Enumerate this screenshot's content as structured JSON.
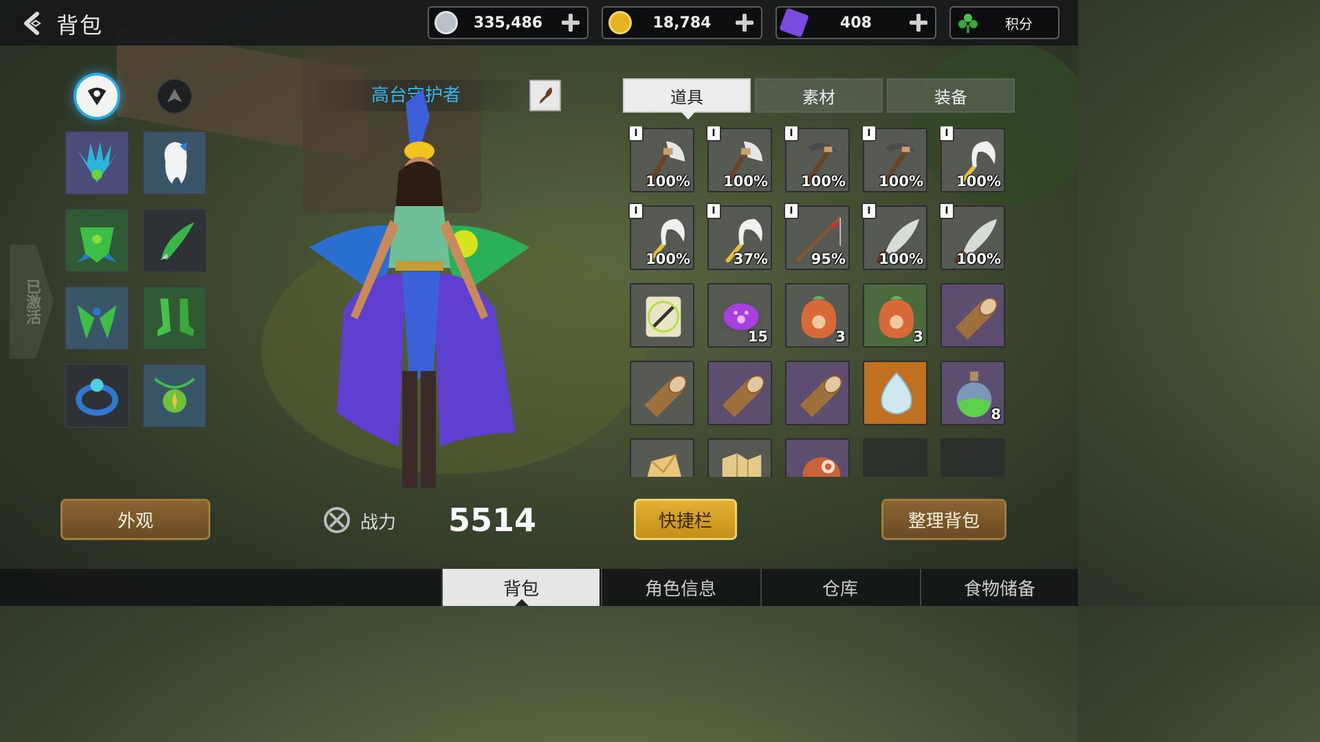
{
  "header": {
    "back_icon": "back-arrow-icon",
    "title": "背包",
    "currencies": [
      {
        "name": "silver-coin",
        "value": "335,486",
        "color": "#b9c0c9"
      },
      {
        "name": "gold-coin",
        "value": "18,784",
        "color": "#e6b422"
      },
      {
        "name": "purple-gem",
        "value": "408",
        "color": "#7b4be0"
      }
    ],
    "score_label": "积分"
  },
  "equipment": {
    "style_icons": [
      "flower-emblem-icon",
      "wing-emblem-icon"
    ],
    "side_tab_label": "已激活",
    "slots": [
      {
        "icon": "feather-headdress-icon",
        "rarity": "purple"
      },
      {
        "icon": "white-hair-icon",
        "rarity": "blue"
      },
      {
        "icon": "leaf-armor-icon",
        "rarity": "green"
      },
      {
        "icon": "green-blade-icon",
        "rarity": "dark"
      },
      {
        "icon": "leaf-gloves-icon",
        "rarity": "blue"
      },
      {
        "icon": "green-boots-icon",
        "rarity": "green"
      },
      {
        "icon": "blue-ring-icon",
        "rarity": "dark"
      },
      {
        "icon": "amulet-icon",
        "rarity": "blue"
      }
    ]
  },
  "character": {
    "name": "高台守护者",
    "rename_icon": "quill-icon",
    "power_label": "战力",
    "power_value": "5514",
    "appearance_button": "外观"
  },
  "inventory": {
    "tabs": [
      "道具",
      "素材",
      "装备"
    ],
    "active_tab": 0,
    "items": [
      {
        "icon": "stone-axe-icon",
        "label": "100%",
        "locked": true,
        "bg": "gray"
      },
      {
        "icon": "stone-axe-icon",
        "label": "100%",
        "locked": true,
        "bg": "gray"
      },
      {
        "icon": "pickaxe-icon",
        "label": "100%",
        "locked": true,
        "bg": "gray"
      },
      {
        "icon": "pickaxe-icon",
        "label": "100%",
        "locked": true,
        "bg": "gray"
      },
      {
        "icon": "sickle-icon",
        "label": "100%",
        "locked": true,
        "bg": "gray"
      },
      {
        "icon": "sickle-icon",
        "label": "100%",
        "locked": true,
        "bg": "gray"
      },
      {
        "icon": "sickle-icon",
        "label": "37%",
        "locked": true,
        "bg": "gray"
      },
      {
        "icon": "fishing-rod-icon",
        "label": "95%",
        "locked": true,
        "bg": "gray"
      },
      {
        "icon": "stone-knife-icon",
        "label": "100%",
        "locked": true,
        "bg": "gray"
      },
      {
        "icon": "stone-knife-icon",
        "label": "100%",
        "locked": true,
        "bg": "gray"
      },
      {
        "icon": "scroll-icon",
        "label": "",
        "locked": false,
        "bg": "gray"
      },
      {
        "icon": "paw-stone-icon",
        "label": "15",
        "locked": false,
        "bg": "gray"
      },
      {
        "icon": "seed-bag-icon",
        "label": "3",
        "locked": false,
        "bg": "gray"
      },
      {
        "icon": "seed-bag-icon",
        "label": "3",
        "locked": false,
        "bg": "green"
      },
      {
        "icon": "wood-log-icon",
        "label": "",
        "locked": false,
        "bg": "purple"
      },
      {
        "icon": "wood-log-icon",
        "label": "",
        "locked": false,
        "bg": "gray"
      },
      {
        "icon": "wood-log-icon",
        "label": "",
        "locked": false,
        "bg": "purple"
      },
      {
        "icon": "wood-log-icon",
        "label": "",
        "locked": false,
        "bg": "purple"
      },
      {
        "icon": "water-drop-icon",
        "label": "",
        "locked": false,
        "bg": "orange"
      },
      {
        "icon": "potion-icon",
        "label": "8",
        "locked": false,
        "bg": "purple"
      },
      {
        "icon": "fabric-icon",
        "label": "",
        "locked": false,
        "bg": "gray"
      },
      {
        "icon": "map-icon",
        "label": "",
        "locked": false,
        "bg": "gray"
      },
      {
        "icon": "meat-icon",
        "label": "",
        "locked": false,
        "bg": "purple"
      },
      {
        "icon": "",
        "label": "",
        "locked": false,
        "bg": "empty"
      },
      {
        "icon": "",
        "label": "",
        "locked": false,
        "bg": "empty"
      }
    ],
    "quickbar_button": "快捷栏",
    "sort_button": "整理背包"
  },
  "bottom_nav": {
    "tabs": [
      "背包",
      "角色信息",
      "仓库",
      "食物储备"
    ],
    "active": 0
  }
}
